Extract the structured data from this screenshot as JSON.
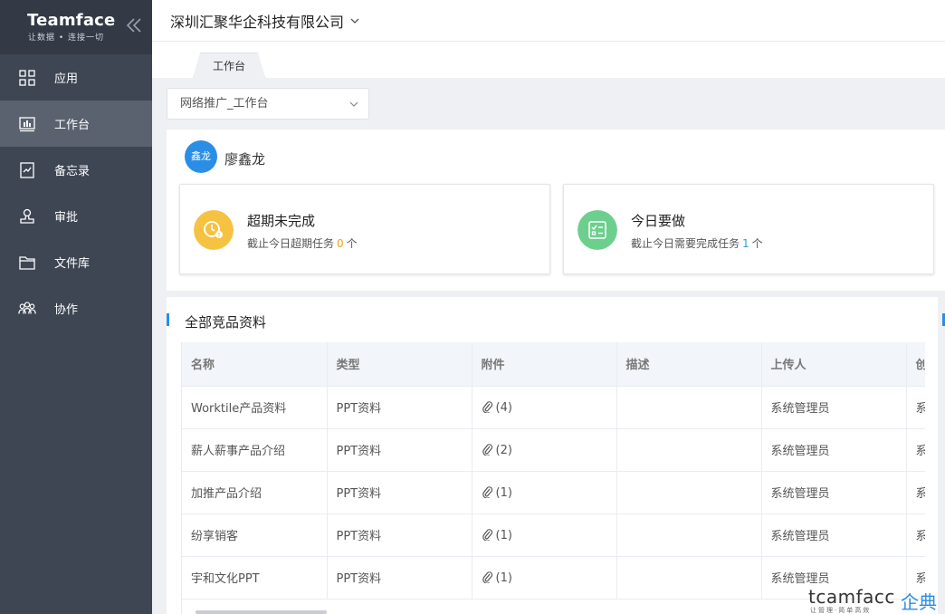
{
  "sidebar": {
    "brand_name": "Teamface",
    "brand_slogan": "让数据 • 连接一切",
    "items": [
      {
        "label": "应用",
        "icon": "grid-icon"
      },
      {
        "label": "工作台",
        "icon": "chart-icon",
        "active": true
      },
      {
        "label": "备忘录",
        "icon": "memo-icon"
      },
      {
        "label": "审批",
        "icon": "approval-icon"
      },
      {
        "label": "文件库",
        "icon": "folder-icon"
      },
      {
        "label": "协作",
        "icon": "team-icon"
      }
    ]
  },
  "header": {
    "company": "深圳汇聚华企科技有限公司"
  },
  "tabs": [
    {
      "label": "工作台"
    }
  ],
  "workspace": {
    "selected": "网络推广_工作台"
  },
  "user": {
    "avatar_text": "鑫龙",
    "name": "廖鑫龙"
  },
  "cards": [
    {
      "title": "超期未完成",
      "desc_prefix": "截止今日超期任务",
      "count": "0",
      "unit": "个",
      "color": "#f5c242",
      "count_color": "#f0a020"
    },
    {
      "title": "今日要做",
      "desc_prefix": "截止今日需要完成任务",
      "count": "1",
      "unit": "个",
      "color": "#6dcf8e",
      "count_color": "#2a9fd6"
    }
  ],
  "table": {
    "title": "全部竞品资料",
    "columns": [
      "名称",
      "类型",
      "附件",
      "描述",
      "上传人",
      "创"
    ],
    "rows": [
      {
        "name": "Worktile产品资料",
        "type": "PPT资料",
        "attachments": "(4)",
        "desc": "",
        "uploader": "系统管理员",
        "extra": "系"
      },
      {
        "name": "薪人薪事产品介绍",
        "type": "PPT资料",
        "attachments": "(2)",
        "desc": "",
        "uploader": "系统管理员",
        "extra": "系"
      },
      {
        "name": "加推产品介绍",
        "type": "PPT资料",
        "attachments": "(1)",
        "desc": "",
        "uploader": "系统管理员",
        "extra": "系"
      },
      {
        "name": "纷享销客",
        "type": "PPT资料",
        "attachments": "(1)",
        "desc": "",
        "uploader": "系统管理员",
        "extra": "系"
      },
      {
        "name": "宇和文化PPT",
        "type": "PPT资料",
        "attachments": "(1)",
        "desc": "",
        "uploader": "系统管理员",
        "extra": "系"
      }
    ]
  },
  "watermark": {
    "en": "tcamfacc",
    "cn": "企典",
    "sub": "让管理·简单高效"
  },
  "colors": {
    "sidebar": "#3e4654",
    "brand": "#333a45",
    "accent": "#2a8ee6"
  }
}
